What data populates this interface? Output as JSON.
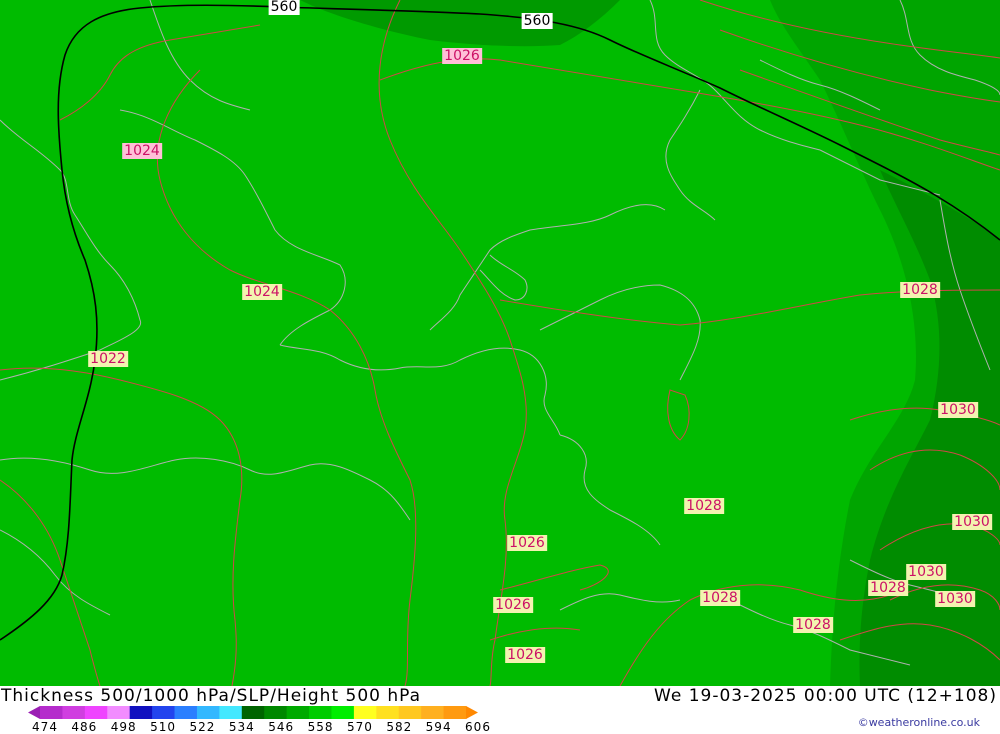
{
  "map": {
    "height_labels": [
      "560",
      "560"
    ],
    "pressure_labels": {
      "p1026_top": "1026",
      "p1024_a": "1024",
      "p1024_b": "1024",
      "p1022": "1022",
      "p1028_e": "1028",
      "p1030_a": "1030",
      "p1028_c": "1028",
      "p1030_b": "1030",
      "p1026_c": "1026",
      "p1030_c": "1030",
      "p1028_s": "1028",
      "p1030_d": "1030",
      "p1028_s2": "1028",
      "p1026_s": "1026",
      "p1028_s3": "1028",
      "p1026_s2": "1026"
    },
    "colors": {
      "green_main": "#00bb00",
      "green_mid": "#00a500",
      "green_dark": "#008c00",
      "isobar": "#d04848",
      "coast": "#b0b0b0",
      "height_line": "#000000"
    }
  },
  "footer": {
    "title": "Thickness 500/1000 hPa/SLP/Height 500 hPa",
    "datetime": "We 19-03-2025 00:00 UTC (12+108)",
    "credit": "©weatheronline.co.uk",
    "scale_ticks": [
      "474",
      "486",
      "498",
      "510",
      "522",
      "534",
      "546",
      "558",
      "570",
      "582",
      "594",
      "606"
    ],
    "scale_colors": [
      "#9b1fb4",
      "#b52ccc",
      "#d03ee0",
      "#ef44ff",
      "#f28cff",
      "#1111c0",
      "#2244ee",
      "#2b7fff",
      "#33b8ff",
      "#44e8ff",
      "#006400",
      "#008800",
      "#00aa00",
      "#00cc00",
      "#00ee00",
      "#ffff20",
      "#ffe020",
      "#ffc820",
      "#ffb020",
      "#ff9a10",
      "#ff8800"
    ]
  }
}
